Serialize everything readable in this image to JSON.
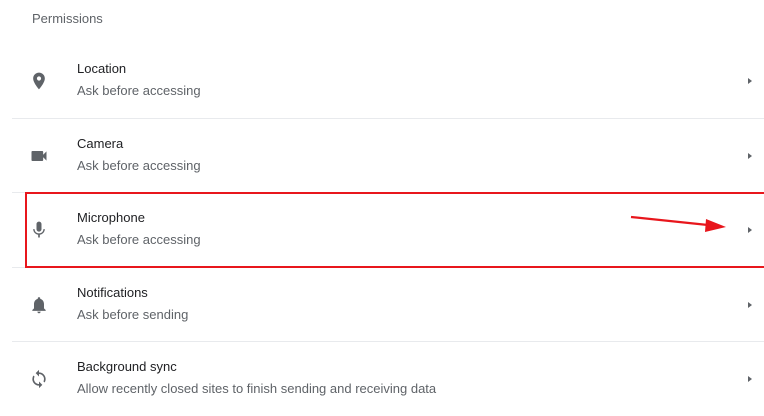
{
  "section": {
    "title": "Permissions"
  },
  "items": [
    {
      "title": "Location",
      "subtitle": "Ask before accessing",
      "icon": "location-pin-icon"
    },
    {
      "title": "Camera",
      "subtitle": "Ask before accessing",
      "icon": "camera-icon"
    },
    {
      "title": "Microphone",
      "subtitle": "Ask before accessing",
      "icon": "microphone-icon"
    },
    {
      "title": "Notifications",
      "subtitle": "Ask before sending",
      "icon": "bell-icon"
    },
    {
      "title": "Background sync",
      "subtitle": "Allow recently closed sites to finish sending and receiving data",
      "icon": "sync-icon"
    }
  ],
  "colors": {
    "icon": "#5f6368",
    "annotation": "#e8161c"
  }
}
